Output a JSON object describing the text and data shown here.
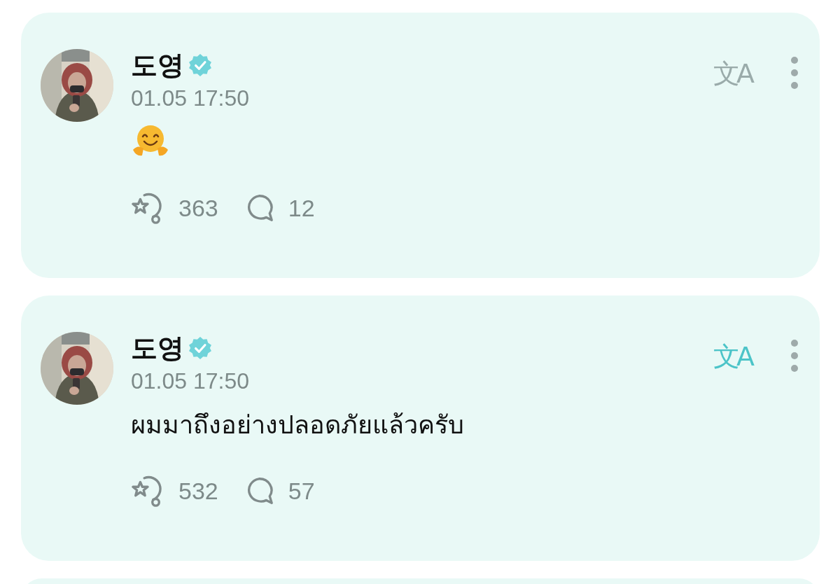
{
  "posts": [
    {
      "author": "도영",
      "verified": true,
      "time": "01.05 17:50",
      "content": {
        "kind": "emoji"
      },
      "translate": {
        "label": "文A",
        "on": false
      },
      "reactions": "363",
      "comments": "12"
    },
    {
      "author": "도영",
      "verified": true,
      "time": "01.05 17:50",
      "content": {
        "kind": "text",
        "text": "ผมมาถึงอย่างปลอดภัยแล้วครับ"
      },
      "translate": {
        "label": "文A",
        "on": true
      },
      "reactions": "532",
      "comments": "57"
    }
  ]
}
